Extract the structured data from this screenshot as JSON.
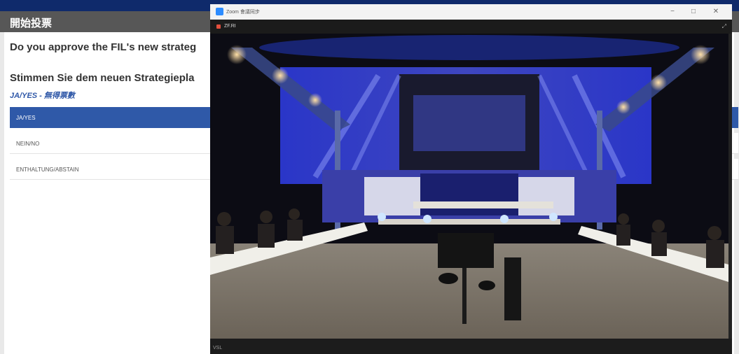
{
  "app": {
    "title": "開始投票",
    "question_en": "Do you approve the FIL's new strateg",
    "question_de": "Stimmen Sie dem neuen Strategiepla",
    "selection": "JA/YES - 無得票數",
    "options": [
      {
        "label": "JA/YES",
        "selected": true
      },
      {
        "label": "NEIN/NO",
        "selected": false
      },
      {
        "label": "ENTHALTUNG/ABSTAIN",
        "selected": false
      }
    ]
  },
  "zoom": {
    "window_title": "Zoom 會議同步",
    "participant": "ZF.RI",
    "bottom_text": "VSL",
    "controls": {
      "minimize": "−",
      "maximize": "□",
      "close": "✕"
    }
  },
  "colors": {
    "accent": "#2f59a8",
    "header": "#575757",
    "zoom_blue": "#2d8cff"
  }
}
